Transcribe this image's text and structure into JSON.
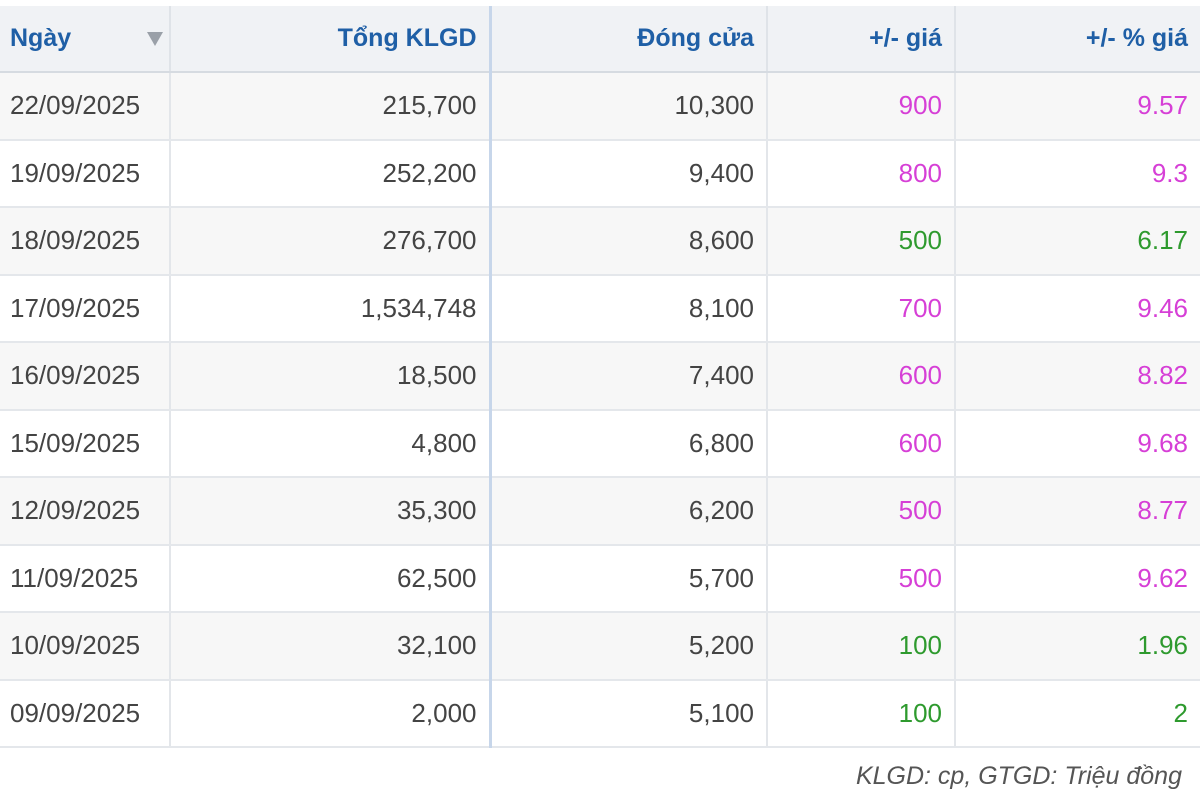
{
  "table": {
    "headers": {
      "date": "Ngày",
      "volume": "Tổng KLGD",
      "close": "Đóng cửa",
      "change": "+/- giá",
      "change_pct": "+/- % giá"
    },
    "sort_icon": "sort-down-triangle",
    "rows": [
      {
        "date": "22/09/2025",
        "volume": "215,700",
        "close": "10,300",
        "change": "900",
        "change_pct": "9.57",
        "color": "#d63fd6"
      },
      {
        "date": "19/09/2025",
        "volume": "252,200",
        "close": "9,400",
        "change": "800",
        "change_pct": "9.3",
        "color": "#d63fd6"
      },
      {
        "date": "18/09/2025",
        "volume": "276,700",
        "close": "8,600",
        "change": "500",
        "change_pct": "6.17",
        "color": "#2e9a2e"
      },
      {
        "date": "17/09/2025",
        "volume": "1,534,748",
        "close": "8,100",
        "change": "700",
        "change_pct": "9.46",
        "color": "#d63fd6"
      },
      {
        "date": "16/09/2025",
        "volume": "18,500",
        "close": "7,400",
        "change": "600",
        "change_pct": "8.82",
        "color": "#d63fd6"
      },
      {
        "date": "15/09/2025",
        "volume": "4,800",
        "close": "6,800",
        "change": "600",
        "change_pct": "9.68",
        "color": "#d63fd6"
      },
      {
        "date": "12/09/2025",
        "volume": "35,300",
        "close": "6,200",
        "change": "500",
        "change_pct": "8.77",
        "color": "#d63fd6"
      },
      {
        "date": "11/09/2025",
        "volume": "62,500",
        "close": "5,700",
        "change": "500",
        "change_pct": "9.62",
        "color": "#d63fd6"
      },
      {
        "date": "10/09/2025",
        "volume": "32,100",
        "close": "5,200",
        "change": "100",
        "change_pct": "1.96",
        "color": "#2e9a2e"
      },
      {
        "date": "09/09/2025",
        "volume": "2,000",
        "close": "5,100",
        "change": "100",
        "change_pct": "2",
        "color": "#2e9a2e"
      }
    ]
  },
  "footnote": "KLGD: cp, GTGD: Triệu đồng"
}
